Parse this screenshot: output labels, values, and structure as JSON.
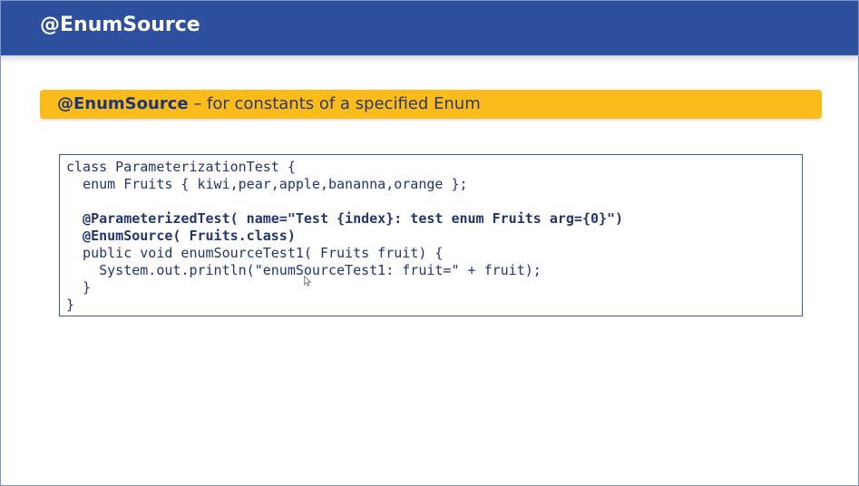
{
  "header": {
    "title": "@EnumSource"
  },
  "banner": {
    "annotation": "@EnumSource",
    "description": " – for constants of a specified Enum"
  },
  "code": {
    "lines": [
      "class ParameterizationTest {",
      "  enum Fruits { kiwi,pear,apple,bananna,orange };",
      "",
      "  @ParameterizedTest( name=\"Test {index}: test enum Fruits arg={0}\")",
      "  @EnumSource( Fruits.class)",
      "  public void enumSourceTest1( Fruits fruit) {",
      "    System.out.println(\"enumSourceTest1: fruit=\" + fruit);",
      "  }",
      "}"
    ]
  },
  "colors": {
    "header_bg": "#2e4f9e",
    "banner_bg": "#fbbb1a",
    "code_text": "#22356e"
  },
  "icons": {
    "cursor": "mouse-pointer-icon"
  }
}
